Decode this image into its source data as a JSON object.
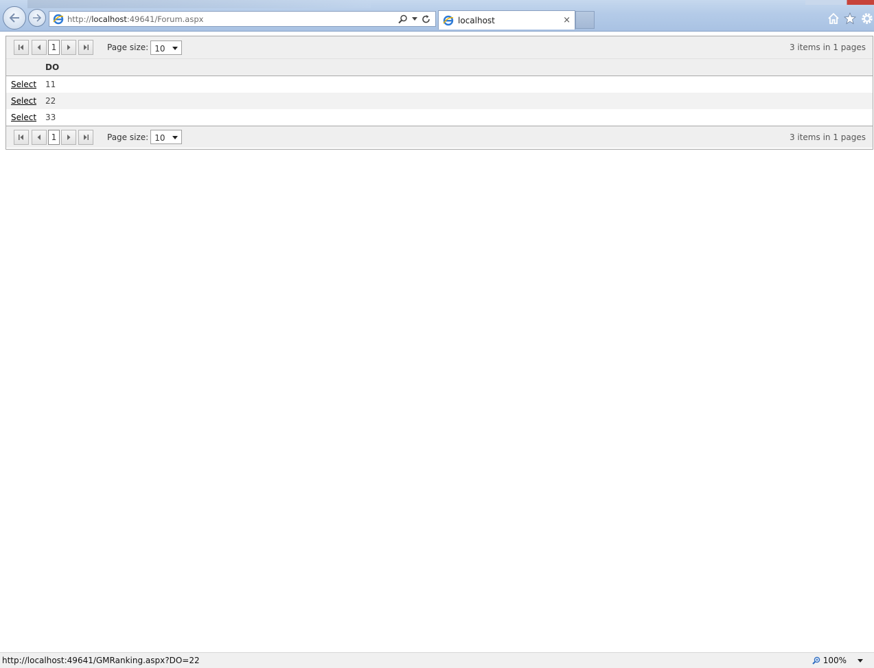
{
  "browser": {
    "address_url_prefix": "http://",
    "address_url_host": "localhost",
    "address_url_rest": ":49641/Forum.aspx",
    "tab_title": "localhost",
    "tab_close": "×"
  },
  "grid": {
    "column_header": "DO",
    "rows": [
      {
        "select_label": "Select",
        "value": "11"
      },
      {
        "select_label": "Select",
        "value": "22"
      },
      {
        "select_label": "Select",
        "value": "33"
      }
    ],
    "pager_top": {
      "page_number": "1",
      "page_size_label": "Page size:",
      "page_size_value": "10",
      "info": "3 items in 1 pages"
    },
    "pager_bottom": {
      "page_number": "1",
      "page_size_label": "Page size:",
      "page_size_value": "10",
      "info": "3 items in 1 pages"
    }
  },
  "statusbar": {
    "link_url": "http://localhost:49641/GMRanking.aspx?DO=22",
    "zoom": "100%"
  },
  "icons": [
    "back-arrow-icon",
    "forward-arrow-icon",
    "ie-logo-icon",
    "search-icon",
    "refresh-icon",
    "home-icon",
    "star-icon",
    "gear-icon",
    "zoom-icon"
  ]
}
